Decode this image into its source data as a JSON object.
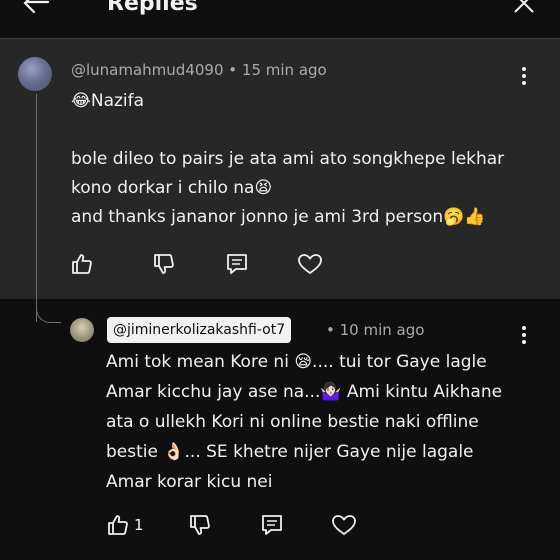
{
  "header": {
    "title": "Replies"
  },
  "comment": {
    "handle": "@lunamahmud4090",
    "separator": "•",
    "time": "15 min ago",
    "lines": [
      "😂Nazifa",
      "bole dileo to pairs je ata ami ato songkhepe lekhar",
      "kono dorkar i chilo na😫",
      "and thanks jananor jonno je ami 3rd person🥱👍"
    ]
  },
  "reply": {
    "handle": "@jiminerkolizakashfi-ot7",
    "separator": "•",
    "time": "10 min ago",
    "lines": [
      "Ami tok mean Kore ni 😪.... tui tor Gaye lagle",
      "Amar kicchu jay ase na...🤷🏻‍♀️ Ami kintu Aikhane",
      "ata o ullekh Kori ni online bestie naki offline",
      "bestie 👌🏻... SE khetre nijer Gaye nije lagale",
      "Amar korar kicu nei"
    ],
    "like_count": "1"
  },
  "icons": {
    "back": "back-arrow-icon",
    "close": "close-icon",
    "like": "thumbs-up-icon",
    "dislike": "thumbs-down-icon",
    "reply": "reply-icon",
    "heart": "heart-icon",
    "more": "more-vert-icon"
  },
  "colors": {
    "background": "#0f0f0f",
    "comment_background": "#272727",
    "text": "#f1f1f1",
    "meta": "#aaaaaa",
    "handle_chip": "#f1f1f1"
  }
}
